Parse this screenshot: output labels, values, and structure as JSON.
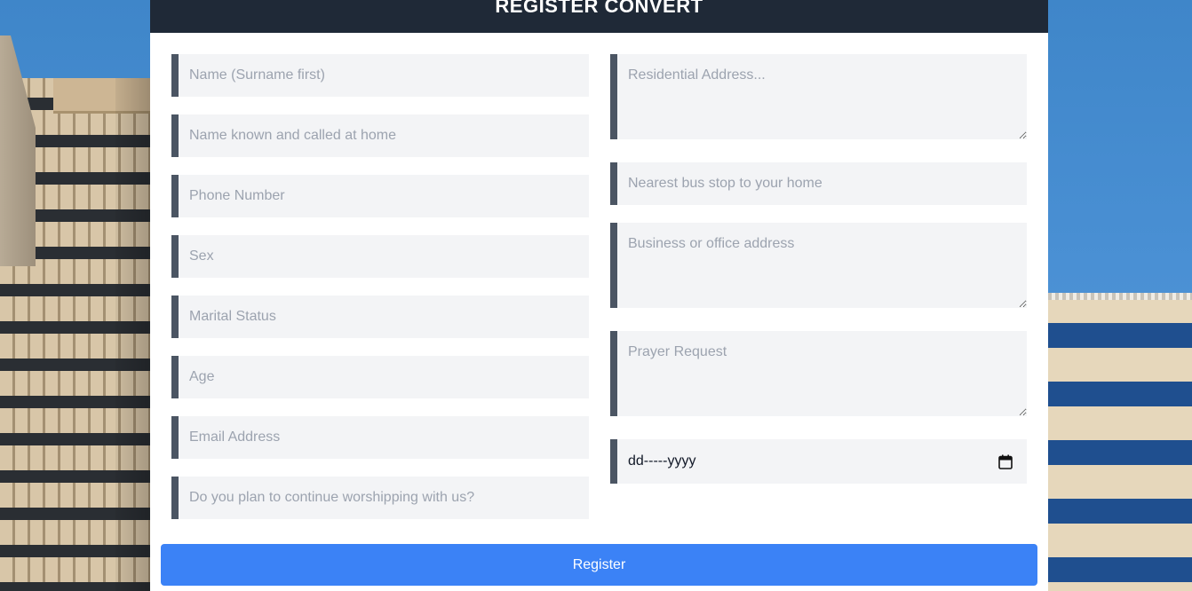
{
  "form": {
    "title": "REGISTER CONVERT",
    "left_fields": [
      {
        "placeholder": "Name (Surname first)"
      },
      {
        "placeholder": "Name known and called at home"
      },
      {
        "placeholder": "Phone Number"
      },
      {
        "placeholder": "Sex"
      },
      {
        "placeholder": "Marital Status"
      },
      {
        "placeholder": "Age"
      },
      {
        "placeholder": "Email Address"
      },
      {
        "placeholder": "Do you plan to continue worshipping with us?"
      }
    ],
    "right_fields": {
      "residential_address": {
        "placeholder": "Residential Address..."
      },
      "bus_stop": {
        "placeholder": "Nearest bus stop to your home"
      },
      "business_address": {
        "placeholder": "Business or office address"
      },
      "prayer_request": {
        "placeholder": "Prayer Request"
      },
      "date": {
        "value": "dd-----yyyy",
        "icon": "calendar-icon"
      }
    },
    "submit_label": "Register"
  },
  "colors": {
    "header_bg": "#1f2937",
    "field_bg": "#f3f4f6",
    "field_accent": "#4b5563",
    "button_bg": "#3b82f6"
  }
}
